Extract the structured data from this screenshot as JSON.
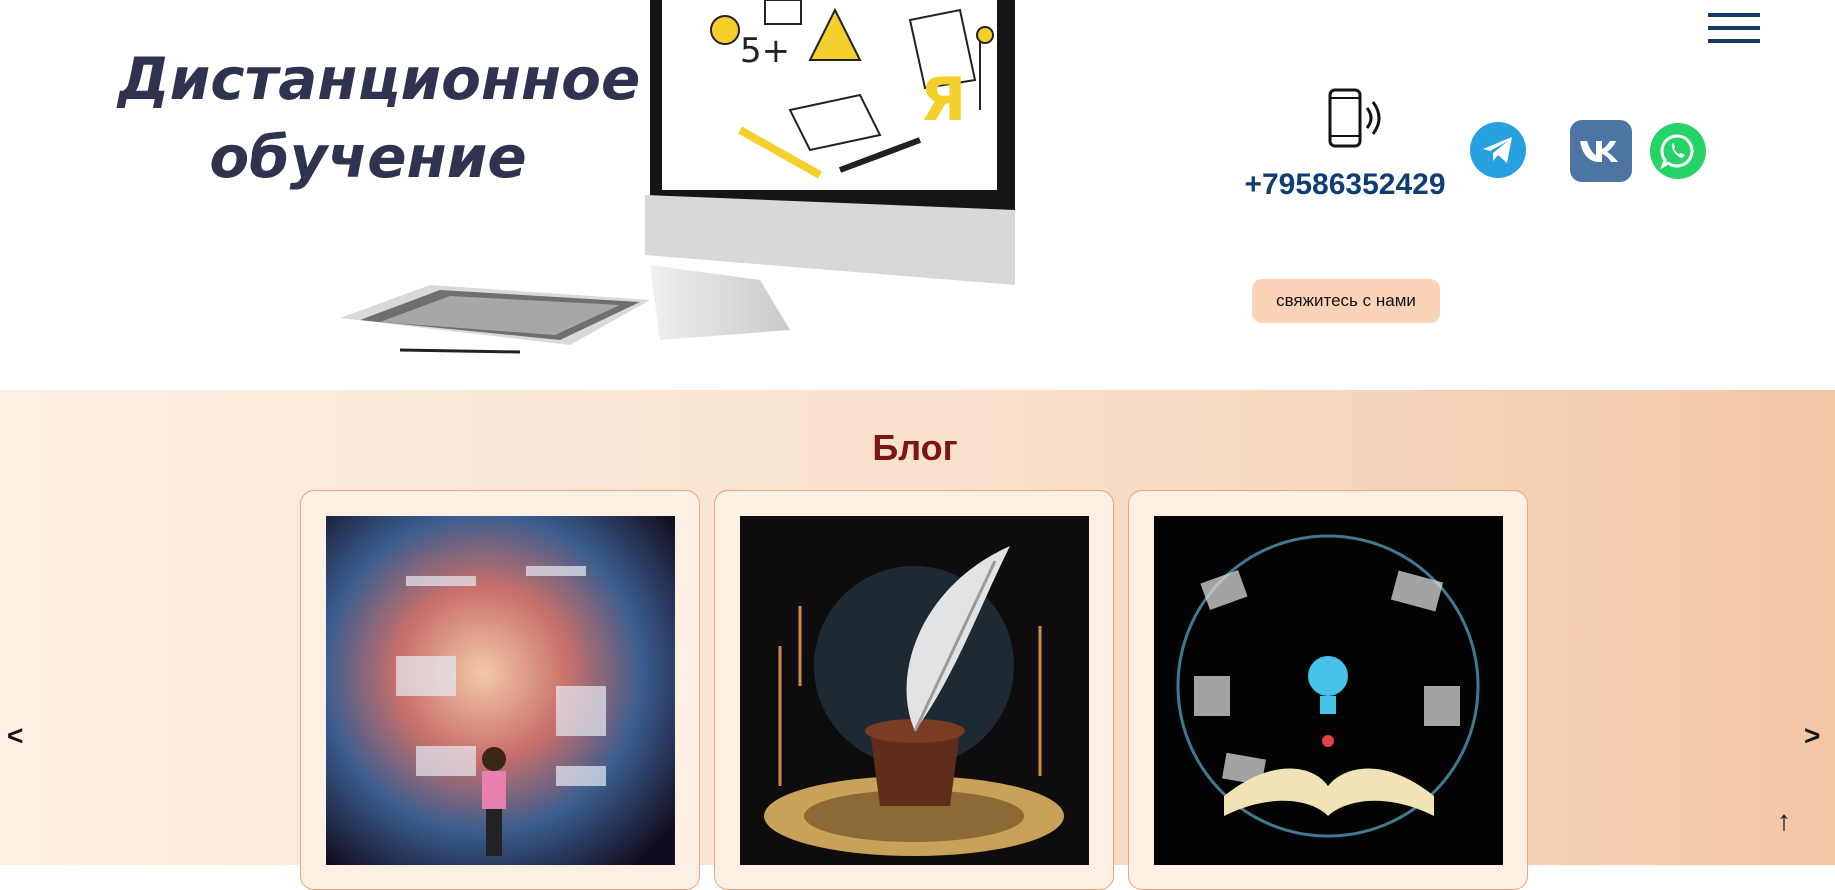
{
  "header": {
    "hero_title_line1": "Дистанционное",
    "hero_title_line2": "обучение",
    "phone_number": "+79586352429",
    "contact_button_label": "свяжитесь с нами"
  },
  "social_links": [
    "telegram-icon",
    "vk-icon",
    "whatsapp-icon"
  ],
  "blog": {
    "title": "Блог",
    "prev_label": "<",
    "next_label": ">"
  },
  "scroll_top_label": "↑",
  "colors": {
    "phone_text": "#0f3e75",
    "blog_title": "#7e1414",
    "contact_button_bg": "#fbd3b6",
    "menu_icon": "#133a69",
    "telegram": "#24a1de",
    "vk": "#4c75a3",
    "whatsapp": "#25d366"
  }
}
